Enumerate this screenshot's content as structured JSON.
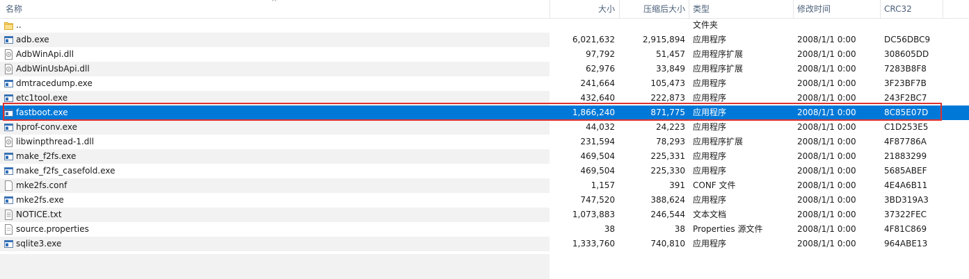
{
  "columns": {
    "name": "名称",
    "size": "大小",
    "packed": "压缩后大小",
    "type": "类型",
    "modified": "修改时间",
    "crc": "CRC32"
  },
  "selection_color": "#0078d7",
  "highlight_color": "#e0312d",
  "rows": [
    {
      "name": "..",
      "size": "",
      "packed": "",
      "type": "文件夹",
      "modified": "",
      "crc": "",
      "icon": "folder-icon"
    },
    {
      "name": "adb.exe",
      "size": "6,021,632",
      "packed": "2,915,894",
      "type": "应用程序",
      "modified": "2008/1/1 0:00",
      "crc": "DC56DBC9",
      "icon": "exe-icon"
    },
    {
      "name": "AdbWinApi.dll",
      "size": "97,792",
      "packed": "51,457",
      "type": "应用程序扩展",
      "modified": "2008/1/1 0:00",
      "crc": "308605DD",
      "icon": "dll-icon"
    },
    {
      "name": "AdbWinUsbApi.dll",
      "size": "62,976",
      "packed": "33,849",
      "type": "应用程序扩展",
      "modified": "2008/1/1 0:00",
      "crc": "7283B8F8",
      "icon": "dll-icon"
    },
    {
      "name": "dmtracedump.exe",
      "size": "241,664",
      "packed": "105,473",
      "type": "应用程序",
      "modified": "2008/1/1 0:00",
      "crc": "3F23BF7B",
      "icon": "exe-icon"
    },
    {
      "name": "etc1tool.exe",
      "size": "432,640",
      "packed": "222,873",
      "type": "应用程序",
      "modified": "2008/1/1 0:00",
      "crc": "243F2BC7",
      "icon": "exe-icon"
    },
    {
      "name": "fastboot.exe",
      "size": "1,866,240",
      "packed": "871,775",
      "type": "应用程序",
      "modified": "2008/1/1 0:00",
      "crc": "8C85E07D",
      "icon": "exe-icon",
      "selected": true
    },
    {
      "name": "hprof-conv.exe",
      "size": "44,032",
      "packed": "24,223",
      "type": "应用程序",
      "modified": "2008/1/1 0:00",
      "crc": "C1D253E5",
      "icon": "exe-icon"
    },
    {
      "name": "libwinpthread-1.dll",
      "size": "231,594",
      "packed": "78,293",
      "type": "应用程序扩展",
      "modified": "2008/1/1 0:00",
      "crc": "4F87786A",
      "icon": "dll-icon"
    },
    {
      "name": "make_f2fs.exe",
      "size": "469,504",
      "packed": "225,331",
      "type": "应用程序",
      "modified": "2008/1/1 0:00",
      "crc": "21883299",
      "icon": "exe-icon"
    },
    {
      "name": "make_f2fs_casefold.exe",
      "size": "469,504",
      "packed": "225,330",
      "type": "应用程序",
      "modified": "2008/1/1 0:00",
      "crc": "5685ABEF",
      "icon": "exe-icon"
    },
    {
      "name": "mke2fs.conf",
      "size": "1,157",
      "packed": "391",
      "type": "CONF 文件",
      "modified": "2008/1/1 0:00",
      "crc": "4E4A6B11",
      "icon": "file-icon"
    },
    {
      "name": "mke2fs.exe",
      "size": "747,520",
      "packed": "388,624",
      "type": "应用程序",
      "modified": "2008/1/1 0:00",
      "crc": "3BD319A3",
      "icon": "exe-icon"
    },
    {
      "name": "NOTICE.txt",
      "size": "1,073,883",
      "packed": "246,544",
      "type": "文本文档",
      "modified": "2008/1/1 0:00",
      "crc": "37322FEC",
      "icon": "text-file-icon"
    },
    {
      "name": "source.properties",
      "size": "38",
      "packed": "38",
      "type": "Properties 源文件",
      "modified": "2008/1/1 0:00",
      "crc": "4F81C869",
      "icon": "properties-file-icon"
    },
    {
      "name": "sqlite3.exe",
      "size": "1,333,760",
      "packed": "740,810",
      "type": "应用程序",
      "modified": "2008/1/1 0:00",
      "crc": "964ABE13",
      "icon": "exe-icon"
    }
  ]
}
